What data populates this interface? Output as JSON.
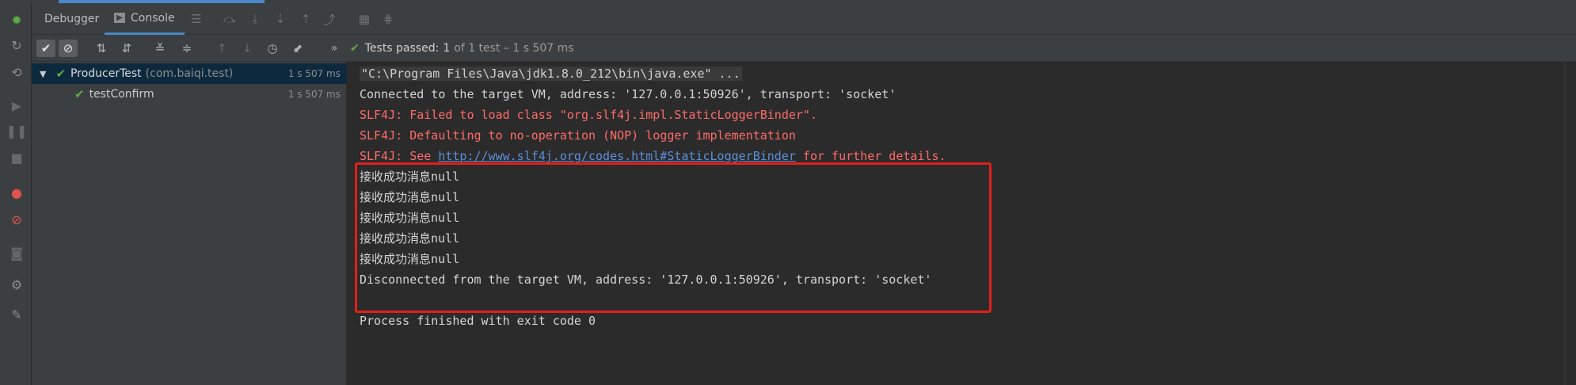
{
  "tabs": [
    {
      "label": "Debugger"
    },
    {
      "label": "Console"
    }
  ],
  "testbar": {
    "status_prefix": "Tests passed:",
    "status_count": "1",
    "status_suffix": "of 1 test – 1 s 507 ms",
    "overflow": "»"
  },
  "tree": [
    {
      "name": "ProducerTest",
      "pkg": "(com.baiqi.test)",
      "time": "1 s 507 ms"
    },
    {
      "name": "testConfirm",
      "time": "1 s 507 ms"
    }
  ],
  "console": {
    "cmd": "\"C:\\Program Files\\Java\\jdk1.8.0_212\\bin\\java.exe\" ...",
    "connected": "Connected to the target VM, address: '127.0.0.1:50926', transport: 'socket'",
    "err1": "SLF4J: Failed to load class \"org.slf4j.impl.StaticLoggerBinder\".",
    "err2": "SLF4J: Defaulting to no-operation (NOP) logger implementation",
    "err3_prefix": "SLF4J: See ",
    "err3_link": "http://www.slf4j.org/codes.html#StaticLoggerBinder",
    "err3_suffix": " for further details.",
    "msgs": [
      "接收成功消息null",
      "接收成功消息null",
      "接收成功消息null",
      "接收成功消息null",
      "接收成功消息null"
    ],
    "disconnected": "Disconnected from the target VM, address: '127.0.0.1:50926', transport: 'socket'",
    "finished": "Process finished with exit code 0"
  }
}
